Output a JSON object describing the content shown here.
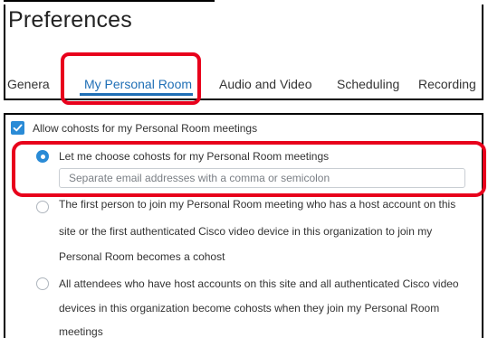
{
  "header": {
    "title": "Preferences"
  },
  "tabs": [
    {
      "label": "Genera"
    },
    {
      "label": "My Personal Room",
      "active": true
    },
    {
      "label": "Audio and Video"
    },
    {
      "label": "Scheduling"
    },
    {
      "label": "Recording"
    }
  ],
  "cohosts": {
    "allow_checkbox": {
      "label": "Allow cohosts for my Personal Room meetings",
      "checked": true
    },
    "options": [
      {
        "lines": [
          "Let me choose cohosts for my Personal Room meetings"
        ],
        "selected": true
      },
      {
        "lines": [
          "The first person to join my Personal Room meeting who has a host account on this",
          "site or the first authenticated Cisco video device in this organization to join my",
          "Personal Room becomes a cohost"
        ],
        "selected": false
      },
      {
        "lines": [
          "All attendees who have host accounts on this site and all authenticated Cisco video",
          "devices in this organization become cohosts when they join my Personal Room",
          "meetings"
        ],
        "selected": false
      }
    ],
    "email_input": {
      "value": "",
      "placeholder": "Separate email addresses with a comma or semicolon"
    }
  },
  "colors": {
    "accent": "#1f6fb6",
    "checkbox": "#2a8bd6",
    "highlight": "#e8001c"
  }
}
